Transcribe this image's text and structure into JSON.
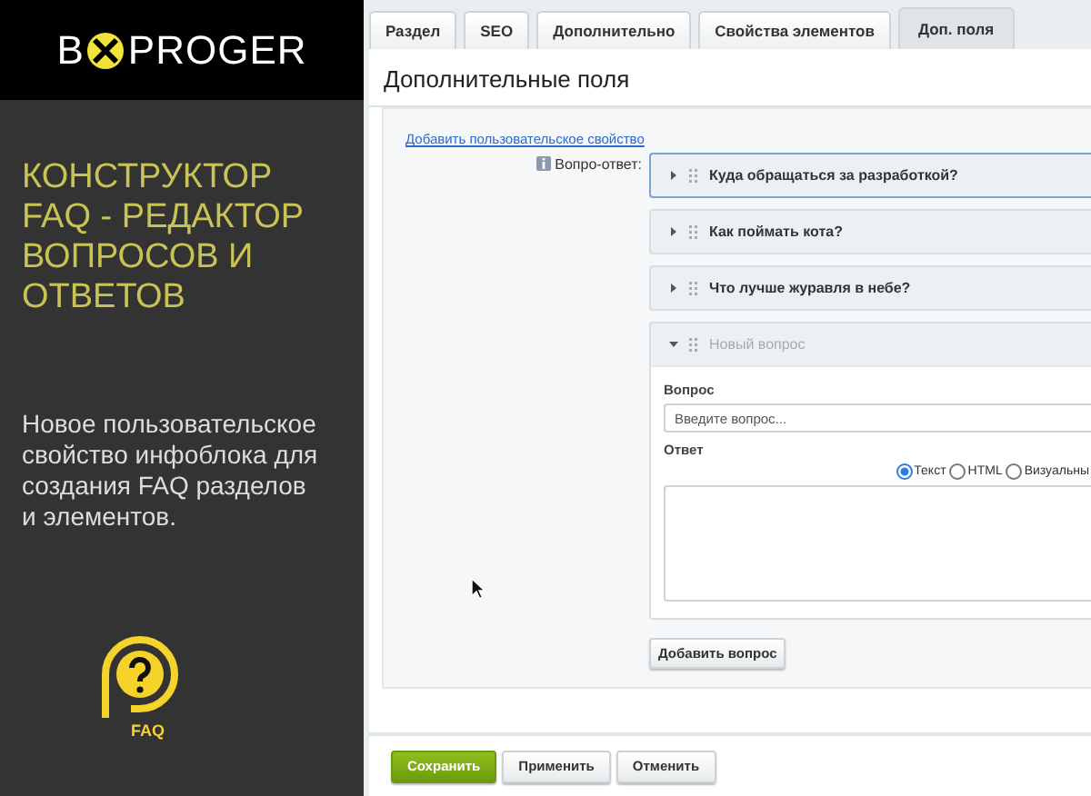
{
  "promo": {
    "logo_left": "B",
    "logo_right": "PROGER",
    "title": "КОНСТРУКТОР FAQ - РЕДАКТОР ВОПРОСОВ И ОТВЕТОВ",
    "description": "Новое пользовательское свойство инфоблока для создания FAQ разделов и элементов.",
    "badge": "FAQ"
  },
  "tabs": [
    {
      "label": "Раздел",
      "selected": false
    },
    {
      "label": "SEO",
      "selected": false
    },
    {
      "label": "Дополнительно",
      "selected": false
    },
    {
      "label": "Свойства элементов",
      "selected": false
    },
    {
      "label": "Доп. поля",
      "selected": true
    }
  ],
  "panel": {
    "title": "Дополнительные поля",
    "add_property_link": "Добавить пользовательское свойство",
    "field_label": "Вопро-ответ:",
    "questions": [
      {
        "title": "Куда обращаться за разработкой?",
        "expanded": false,
        "focused": true
      },
      {
        "title": "Как поймать кота?",
        "expanded": false,
        "focused": false
      },
      {
        "title": "Что лучше журавля в небе?",
        "expanded": false,
        "focused": false
      },
      {
        "title": "Новый вопрос",
        "expanded": true,
        "focused": false,
        "question_label": "Вопрос",
        "question_placeholder": "Введите вопрос...",
        "answer_label": "Ответ",
        "formats": [
          {
            "label": "Текст",
            "selected": true
          },
          {
            "label": "HTML",
            "selected": false
          },
          {
            "label": "Визуальны",
            "selected": false
          }
        ]
      }
    ],
    "add_question_button": "Добавить вопрос"
  },
  "footer": {
    "buttons": [
      {
        "label": "Сохранить",
        "kind": "primary"
      },
      {
        "label": "Применить",
        "kind": "normal"
      },
      {
        "label": "Отменить",
        "kind": "normal"
      }
    ]
  }
}
